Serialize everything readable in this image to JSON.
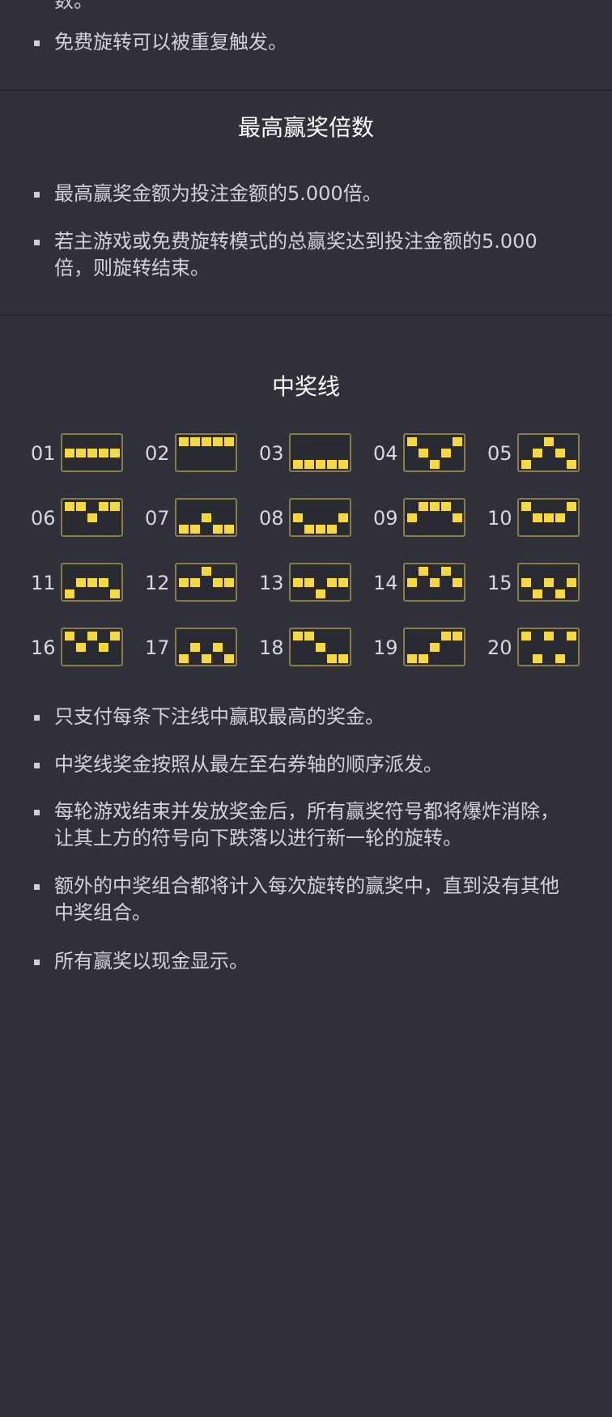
{
  "top_section": {
    "cut_text": "数。",
    "bullets": [
      "免费旋转可以被重复触发。"
    ]
  },
  "max_win": {
    "title": "最高赢奖倍数",
    "bullets": [
      "最高赢奖金额为投注金额的5.000倍。",
      "若主游戏或免费旋转模式的总赢奖达到投注金额的5.000倍，则旋转结束。"
    ]
  },
  "paylines": {
    "title": "中奖线",
    "lines": [
      {
        "number": "01",
        "pattern": [
          1,
          1,
          1,
          1,
          1
        ]
      },
      {
        "number": "02",
        "pattern": [
          0,
          0,
          0,
          0,
          0
        ]
      },
      {
        "number": "03",
        "pattern": [
          2,
          2,
          2,
          2,
          2
        ]
      },
      {
        "number": "04",
        "pattern": [
          0,
          1,
          2,
          1,
          0
        ]
      },
      {
        "number": "05",
        "pattern": [
          2,
          1,
          0,
          1,
          2
        ]
      },
      {
        "number": "06",
        "pattern": [
          0,
          0,
          1,
          0,
          0
        ]
      },
      {
        "number": "07",
        "pattern": [
          2,
          2,
          1,
          2,
          2
        ]
      },
      {
        "number": "08",
        "pattern": [
          1,
          2,
          2,
          2,
          1
        ]
      },
      {
        "number": "09",
        "pattern": [
          1,
          0,
          0,
          0,
          1
        ]
      },
      {
        "number": "10",
        "pattern": [
          0,
          1,
          1,
          1,
          0
        ]
      },
      {
        "number": "11",
        "pattern": [
          2,
          1,
          1,
          1,
          2
        ]
      },
      {
        "number": "12",
        "pattern": [
          1,
          1,
          0,
          1,
          1
        ]
      },
      {
        "number": "13",
        "pattern": [
          1,
          1,
          2,
          1,
          1
        ]
      },
      {
        "number": "14",
        "pattern": [
          1,
          0,
          1,
          0,
          1
        ]
      },
      {
        "number": "15",
        "pattern": [
          1,
          2,
          1,
          2,
          1
        ]
      },
      {
        "number": "16",
        "pattern": [
          0,
          1,
          0,
          1,
          0
        ]
      },
      {
        "number": "17",
        "pattern": [
          2,
          1,
          2,
          1,
          2
        ]
      },
      {
        "number": "18",
        "pattern": [
          0,
          0,
          1,
          2,
          2
        ]
      },
      {
        "number": "19",
        "pattern": [
          2,
          2,
          1,
          0,
          0
        ]
      },
      {
        "number": "20",
        "pattern": [
          0,
          2,
          0,
          2,
          0
        ]
      }
    ],
    "bullets": [
      "只支付每条下注线中赢取最高的奖金。",
      "中奖线奖金按照从最左至右券轴的顺序派发。",
      "每轮游戏结束并发放奖金后，所有赢奖符号都将爆炸消除，让其上方的符号向下跌落以进行新一轮的旋转。",
      "额外的中奖组合都将计入每次旋转的赢奖中，直到没有其他中奖组合。",
      "所有赢奖以现金显示。"
    ]
  },
  "colors": {
    "background": "#30303b",
    "symbol": "#f6d840",
    "box_border": "#8a7c4a"
  }
}
